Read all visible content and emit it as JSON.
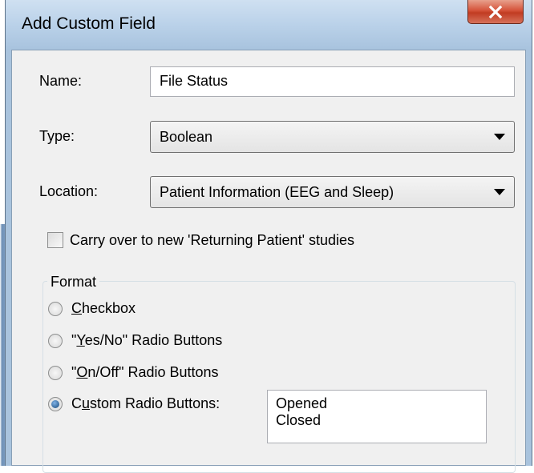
{
  "window": {
    "title": "Add Custom Field"
  },
  "form": {
    "name_label": "Name:",
    "name_value": "File Status",
    "type_label": "Type:",
    "type_value": "Boolean",
    "location_label": "Location:",
    "location_value": "Patient Information (EEG and Sleep)",
    "carry_over_label": "Carry over to new 'Returning Patient' studies",
    "carry_over_checked": false
  },
  "format": {
    "title": "Format",
    "options": [
      {
        "pre": "",
        "accel": "C",
        "post": "heckbox",
        "checked": false
      },
      {
        "pre": "\"",
        "accel": "Y",
        "post": "es/No\" Radio Buttons",
        "checked": false
      },
      {
        "pre": "\"",
        "accel": "O",
        "post": "n/Off\" Radio Buttons",
        "checked": false
      },
      {
        "pre": "C",
        "accel": "u",
        "post": "stom Radio Buttons:",
        "checked": true
      }
    ],
    "custom_values": [
      "Opened",
      "Closed"
    ]
  },
  "colors": {
    "title_bar": "#bcd3ea",
    "client_bg": "#f0f0f0",
    "close_button": "#c13c22",
    "radio_selected": "#17487a"
  },
  "icons": {
    "close": "close-icon"
  }
}
